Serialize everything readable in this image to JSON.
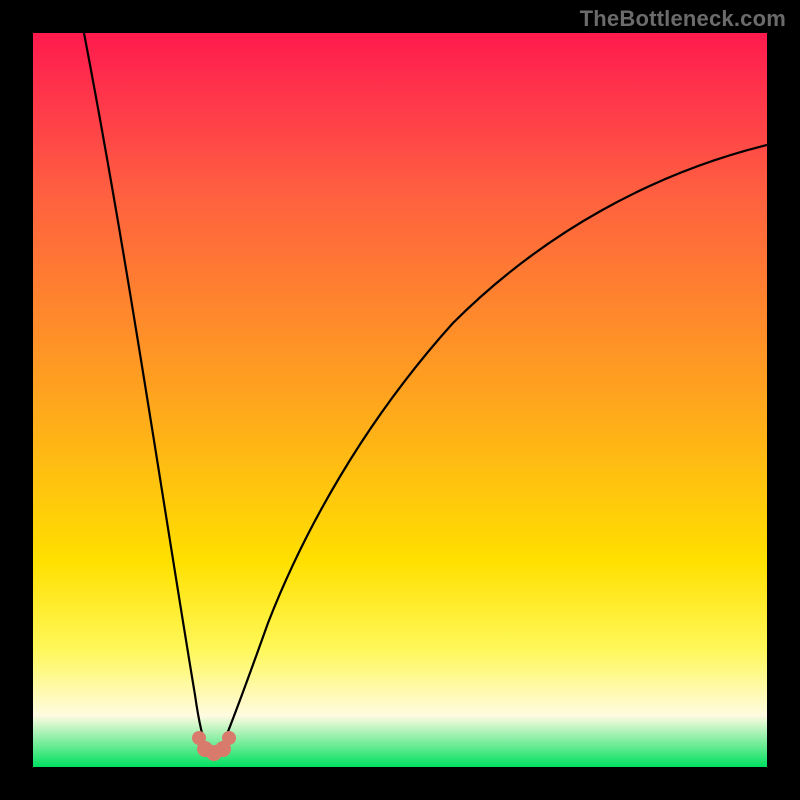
{
  "watermark": "TheBottleneck.com",
  "chart_data": {
    "type": "line",
    "title": "",
    "xlabel": "",
    "ylabel": "",
    "xlim": [
      0,
      100
    ],
    "ylim": [
      0,
      100
    ],
    "grid": false,
    "legend": false,
    "optimum_x": 24,
    "annotations": [
      {
        "name": "optimum-marker",
        "x": 24,
        "y": 2,
        "color": "#d97b6c"
      }
    ],
    "series": [
      {
        "name": "left-branch",
        "x": [
          7,
          9,
          11,
          13,
          15,
          17,
          19,
          20,
          21,
          22,
          22.8
        ],
        "y": [
          100,
          86,
          72,
          58,
          45,
          33,
          22,
          16,
          11,
          6,
          2
        ]
      },
      {
        "name": "right-branch",
        "x": [
          25.2,
          26,
          27,
          29,
          32,
          36,
          41,
          47,
          54,
          62,
          71,
          81,
          92,
          100
        ],
        "y": [
          2,
          6,
          11,
          20,
          30,
          40,
          49,
          57,
          64,
          70,
          75,
          79,
          82.5,
          84.5
        ]
      }
    ]
  }
}
